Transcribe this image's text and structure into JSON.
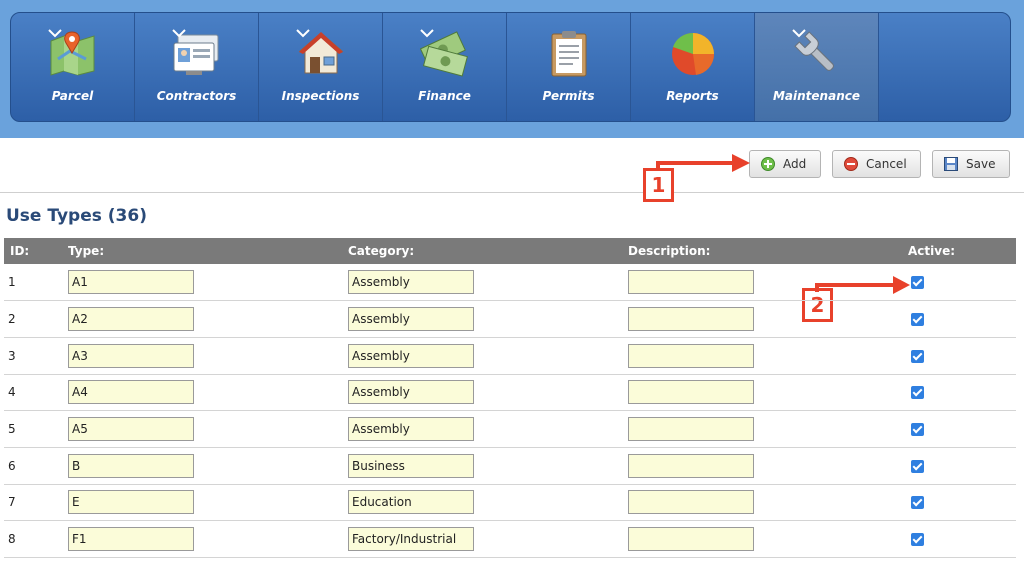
{
  "nav": [
    {
      "label": "Parcel",
      "icon": "map-pin-icon",
      "active": false
    },
    {
      "label": "Contractors",
      "icon": "id-card-icon",
      "active": false
    },
    {
      "label": "Inspections",
      "icon": "house-icon",
      "active": false
    },
    {
      "label": "Finance",
      "icon": "money-icon",
      "active": false
    },
    {
      "label": "Permits",
      "icon": "clipboard-icon",
      "active": false
    },
    {
      "label": "Reports",
      "icon": "pie-chart-icon",
      "active": false
    },
    {
      "label": "Maintenance",
      "icon": "wrench-icon",
      "active": true
    }
  ],
  "toolbar": {
    "add_label": "Add",
    "cancel_label": "Cancel",
    "save_label": "Save"
  },
  "annotations": {
    "one": "1",
    "two": "2"
  },
  "section_title": "Use Types (36)",
  "table": {
    "headers": {
      "id": "ID:",
      "type": "Type:",
      "category": "Category:",
      "description": "Description:",
      "active": "Active:"
    },
    "rows": [
      {
        "id": "1",
        "type": "A1",
        "category": "Assembly",
        "description": "",
        "active": true
      },
      {
        "id": "2",
        "type": "A2",
        "category": "Assembly",
        "description": "",
        "active": true
      },
      {
        "id": "3",
        "type": "A3",
        "category": "Assembly",
        "description": "",
        "active": true
      },
      {
        "id": "4",
        "type": "A4",
        "category": "Assembly",
        "description": "",
        "active": true
      },
      {
        "id": "5",
        "type": "A5",
        "category": "Assembly",
        "description": "",
        "active": true
      },
      {
        "id": "6",
        "type": "B",
        "category": "Business",
        "description": "",
        "active": true
      },
      {
        "id": "7",
        "type": "E",
        "category": "Education",
        "description": "",
        "active": true
      },
      {
        "id": "8",
        "type": "F1",
        "category": "Factory/Industrial",
        "description": "",
        "active": true
      }
    ]
  },
  "colors": {
    "accent": "#2f7fe0",
    "annotation": "#e8412b",
    "nav": "#2d5fa7",
    "input_bg": "#fbfcd9"
  }
}
